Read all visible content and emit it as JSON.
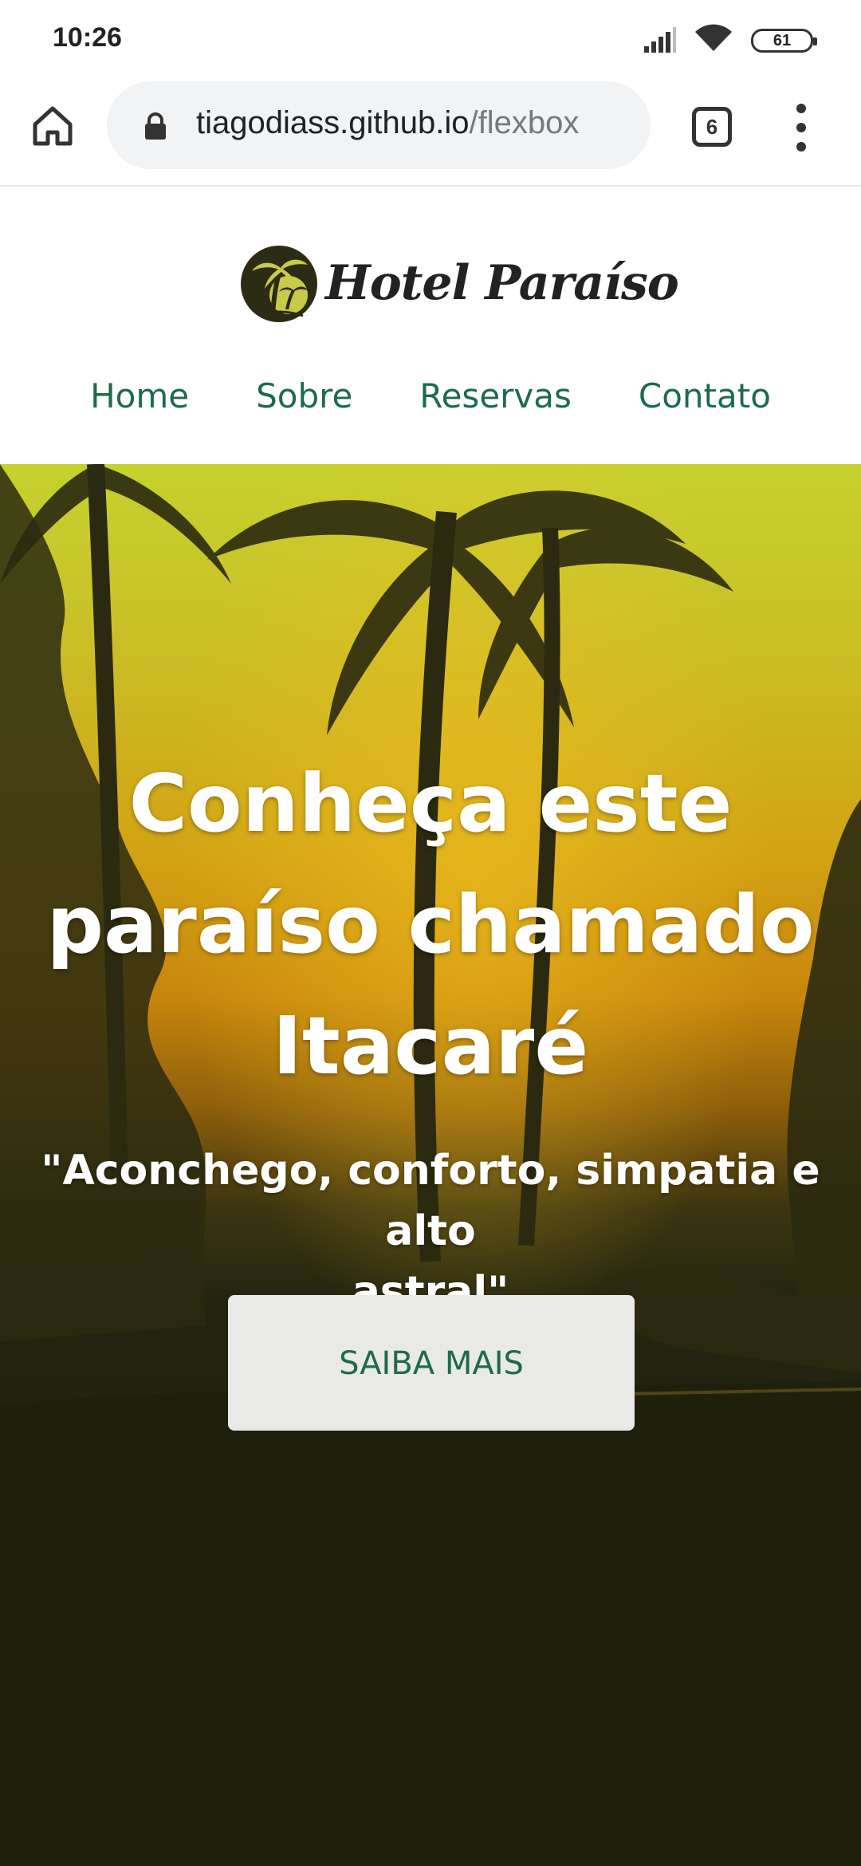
{
  "status_bar": {
    "time": "10:26",
    "battery": "61",
    "icons": [
      "signal-icon",
      "wifi-icon",
      "battery-icon"
    ]
  },
  "browser": {
    "url_host": "tiagodiass.github.io",
    "url_path": "/flexbox",
    "tab_count": "6",
    "icons": [
      "home-icon",
      "lock-icon",
      "tabs-icon",
      "more-vert-icon"
    ]
  },
  "site": {
    "logo_text": "Hotel Paraíso",
    "nav": [
      {
        "label": "Home"
      },
      {
        "label": "Sobre"
      },
      {
        "label": "Reservas"
      },
      {
        "label": "Contato"
      }
    ]
  },
  "hero": {
    "title_line1": "Conheça este",
    "title_line2": "paraíso chamado",
    "title_line3": "Itacaré",
    "subtitle_line1": "\"Aconchego, conforto, simpatia e alto",
    "subtitle_line2": "astral\"",
    "cta_label": "SAIBA MAIS"
  },
  "colors": {
    "nav_text": "#1e6a4c",
    "hero_dark": "#1f200c",
    "hero_sky": "#c6d12f",
    "hero_sun": "#d2a214",
    "cta_bg": "#e9e9e7"
  }
}
